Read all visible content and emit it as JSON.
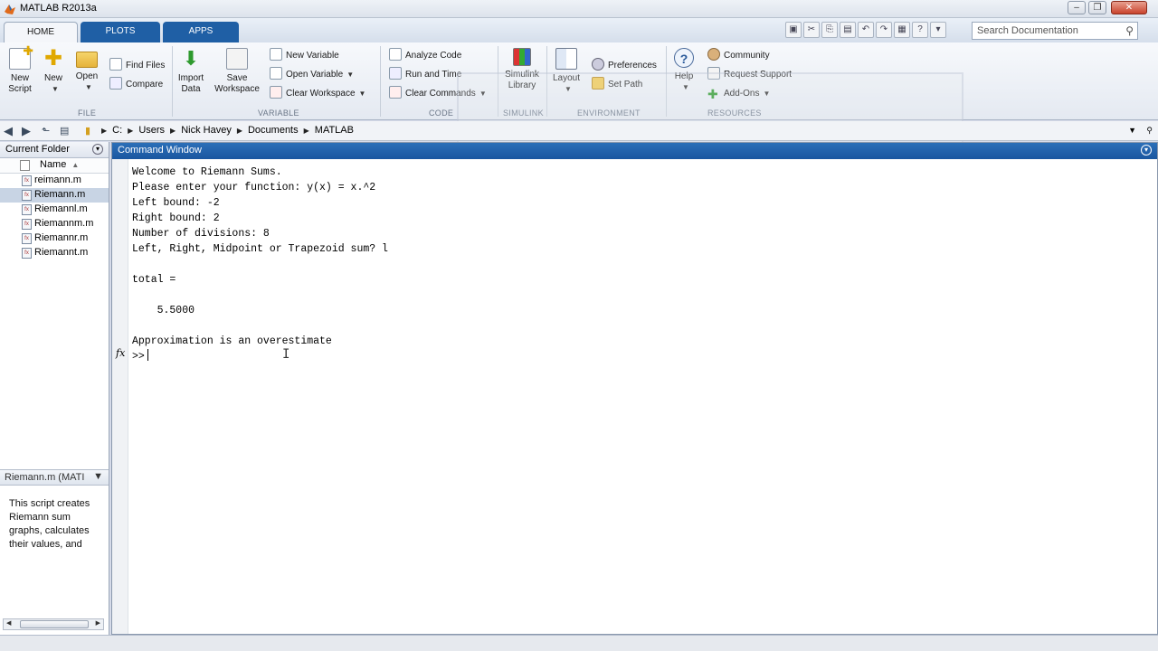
{
  "window": {
    "title": "MATLAB R2013a"
  },
  "tabs": [
    {
      "label": "HOME"
    },
    {
      "label": "PLOTS"
    },
    {
      "label": "APPS"
    }
  ],
  "search": {
    "placeholder": "Search Documentation"
  },
  "ribbon": {
    "file": {
      "group_label": "FILE",
      "new_script": "New\nScript",
      "new": "New",
      "open": "Open",
      "find_files": "Find Files",
      "compare": "Compare"
    },
    "variable": {
      "group_label": "VARIABLE",
      "import_data": "Import\nData",
      "save_workspace": "Save\nWorkspace",
      "new_variable": "New Variable",
      "open_variable": "Open Variable",
      "clear_workspace": "Clear Workspace"
    },
    "code": {
      "group_label": "CODE",
      "analyze_code": "Analyze Code",
      "run_and_time": "Run and Time",
      "clear_commands": "Clear Commands"
    },
    "simulink": {
      "group_label": "SIMULINK",
      "simulink_library": "Simulink\nLibrary"
    },
    "environment": {
      "group_label": "ENVIRONMENT",
      "layout": "Layout",
      "preferences": "Preferences",
      "set_path": "Set Path"
    },
    "resources": {
      "group_label": "RESOURCES",
      "help": "Help",
      "community": "Community",
      "request_support": "Request Support",
      "add_ons": "Add-Ons"
    }
  },
  "address": {
    "crumbs": [
      "C:",
      "Users",
      "Nick Havey",
      "Documents",
      "MATLAB"
    ]
  },
  "current_folder": {
    "title": "Current Folder",
    "column": "Name",
    "files": [
      {
        "name": "reimann.m",
        "selected": false
      },
      {
        "name": "Riemann.m",
        "selected": true
      },
      {
        "name": "Riemannl.m",
        "selected": false
      },
      {
        "name": "Riemannm.m",
        "selected": false
      },
      {
        "name": "Riemannr.m",
        "selected": false
      },
      {
        "name": "Riemannt.m",
        "selected": false
      }
    ],
    "details_title": "Riemann.m (MATI",
    "details_text": "This script creates Riemann sum graphs, calculates their values, and"
  },
  "command_window": {
    "title": "Command Window",
    "lines": [
      "Welcome to Riemann Sums.",
      "Please enter your function: y(x) = x.^2",
      "Left bound: -2",
      "Right bound: 2",
      "Number of divisions: 8",
      "Left, Right, Midpoint or Trapezoid sum? l",
      "",
      "total =",
      "",
      "    5.5000",
      "",
      "Approximation is an overestimate"
    ],
    "prompt": ">>",
    "fx_label": "fx"
  }
}
